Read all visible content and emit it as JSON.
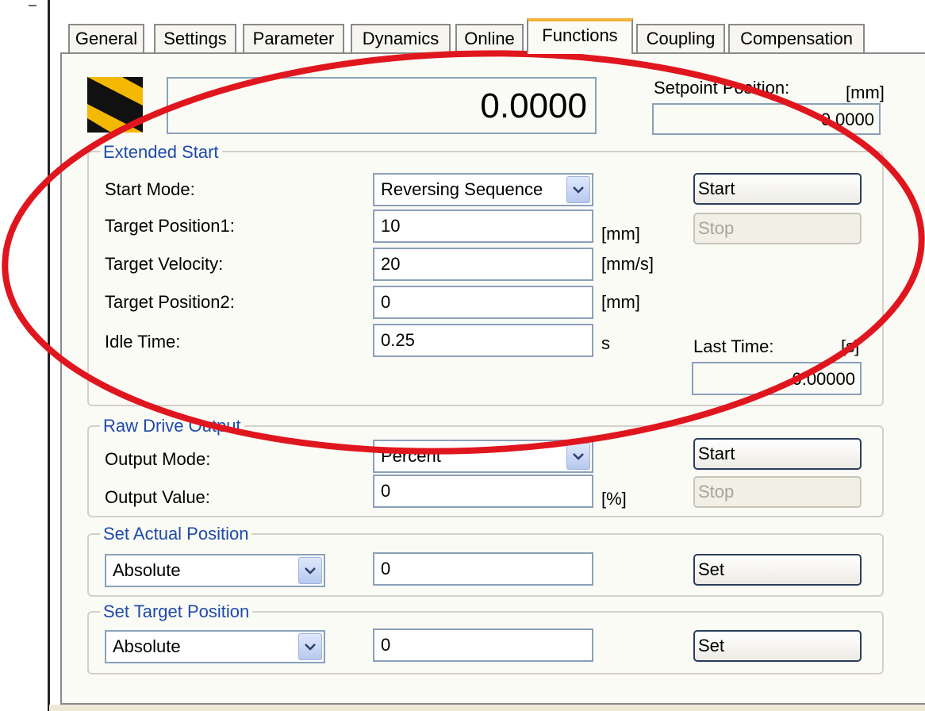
{
  "tabs": [
    {
      "label": "General",
      "active": false
    },
    {
      "label": "Settings",
      "active": false
    },
    {
      "label": "Parameter",
      "active": false
    },
    {
      "label": "Dynamics",
      "active": false
    },
    {
      "label": "Online",
      "active": false
    },
    {
      "label": "Functions",
      "active": true
    },
    {
      "label": "Coupling",
      "active": false
    },
    {
      "label": "Compensation",
      "active": false
    }
  ],
  "display": {
    "value": "0.0000",
    "setpoint_label": "Setpoint Position:",
    "setpoint_unit": "[mm]",
    "setpoint_value": "0.0000"
  },
  "extended_start": {
    "title": "Extended Start",
    "start_mode_label": "Start Mode:",
    "start_mode_value": "Reversing Sequence",
    "target_position1_label": "Target Position1:",
    "target_position1_value": "10",
    "target_position1_unit": "[mm]",
    "target_velocity_label": "Target Velocity:",
    "target_velocity_value": "20",
    "target_velocity_unit": "[mm/s]",
    "target_position2_label": "Target Position2:",
    "target_position2_value": "0",
    "target_position2_unit": "[mm]",
    "idle_time_label": "Idle Time:",
    "idle_time_value": "0.25",
    "idle_time_unit": "s",
    "start_button": "Start",
    "stop_button": "Stop",
    "last_time_label": "Last Time:",
    "last_time_unit": "[s]",
    "last_time_value": "0.00000"
  },
  "raw_drive_output": {
    "title": "Raw Drive Output",
    "output_mode_label": "Output Mode:",
    "output_mode_value": "Percent",
    "output_value_label": "Output Value:",
    "output_value": "0",
    "output_value_unit": "[%]",
    "start_button": "Start",
    "stop_button": "Stop"
  },
  "set_actual_position": {
    "title": "Set Actual Position",
    "mode_value": "Absolute",
    "value": "0",
    "set_button": "Set"
  },
  "set_target_position": {
    "title": "Set Target Position",
    "mode_value": "Absolute",
    "value": "0",
    "set_button": "Set"
  },
  "colors": {
    "annotation": "#e0161e",
    "group_title": "#1e4aa8",
    "active_tab_accent": "#f2b23a",
    "logo_yellow": "#f5b800"
  },
  "icons": {
    "logo": "axis-logo-icon",
    "dropdown": "chevron-down-icon"
  }
}
